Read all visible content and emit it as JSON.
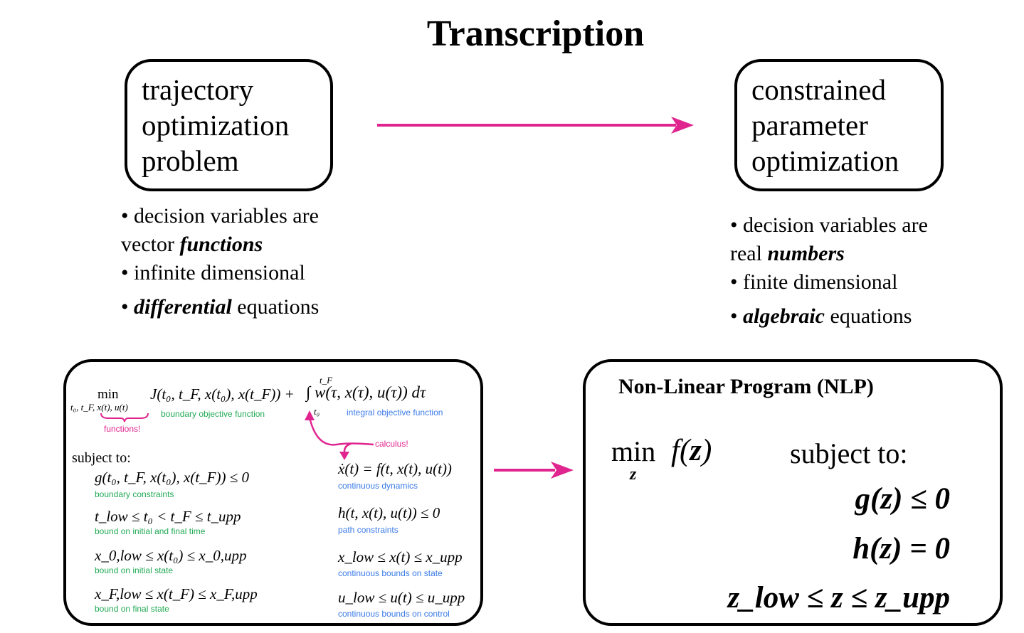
{
  "title": "Transcription",
  "colors": {
    "accent": "#e0258f",
    "green_note": "#22aa55",
    "blue_note": "#3b7be8",
    "border": "#000000"
  },
  "left_box": {
    "lines": [
      "trajectory",
      "optimization",
      "problem"
    ]
  },
  "right_box": {
    "lines": [
      "constrained",
      "parameter",
      "optimization"
    ]
  },
  "left_bullets": {
    "b1_text": "• decision variables are",
    "b1_cont": "vector ",
    "b1_emph": "functions",
    "b2_text": "• infinite dimensional",
    "b3_bullet": "• ",
    "b3_emph": "differential",
    "b3_rest": " equations"
  },
  "right_bullets": {
    "b1_text": "• decision variables are",
    "b1_cont": "real ",
    "b1_emph": "numbers",
    "b2_text": "• finite dimensional",
    "b3_bullet": "• ",
    "b3_emph": "algebraic",
    "b3_rest": " equations"
  },
  "trajectory_problem": {
    "min_label": "min",
    "min_sub": "t₀, t_F, x(t), u(t)",
    "objective_boundary": "J(t₀, t_F, x(t₀), x(t_F)) +",
    "objective_integral": "∫ w(τ, x(τ), u(τ)) dτ",
    "integral_lower": "t₀",
    "integral_upper": "t_F",
    "notes": {
      "functions": "functions!",
      "boundary_objective": "boundary objective function",
      "integral_objective": "integral objective function",
      "calculus": "calculus!"
    },
    "subject_to": "subject to:",
    "constraints_left": [
      {
        "expr": "g(t₀, t_F, x(t₀), x(t_F)) ≤ 0",
        "note": "boundary constraints"
      },
      {
        "expr": "t_low ≤ t₀ < t_F ≤ t_upp",
        "note": "bound on initial and final time"
      },
      {
        "expr": "x_0,low ≤ x(t₀) ≤ x_0,upp",
        "note": "bound on initial state"
      },
      {
        "expr": "x_F,low ≤ x(t_F) ≤ x_F,upp",
        "note": "bound on final state"
      }
    ],
    "constraints_right": [
      {
        "expr": "ẋ(t) = f(t, x(t), u(t))",
        "note": "continuous dynamics"
      },
      {
        "expr": "h(t, x(t), u(t)) ≤ 0",
        "note": "path constraints"
      },
      {
        "expr": "x_low ≤ x(t) ≤ x_upp",
        "note": "continuous bounds on state"
      },
      {
        "expr": "u_low ≤ u(t) ≤ u_upp",
        "note": "continuous bounds on control"
      }
    ]
  },
  "nlp": {
    "title": "Non-Linear Program  (NLP)",
    "objective": "min f(z)",
    "min_label": "min",
    "min_sub": "z",
    "subject_to": "subject to:",
    "constraints": [
      "g(z) ≤ 0",
      "h(z) = 0",
      "z_low ≤ z ≤ z_upp"
    ]
  }
}
